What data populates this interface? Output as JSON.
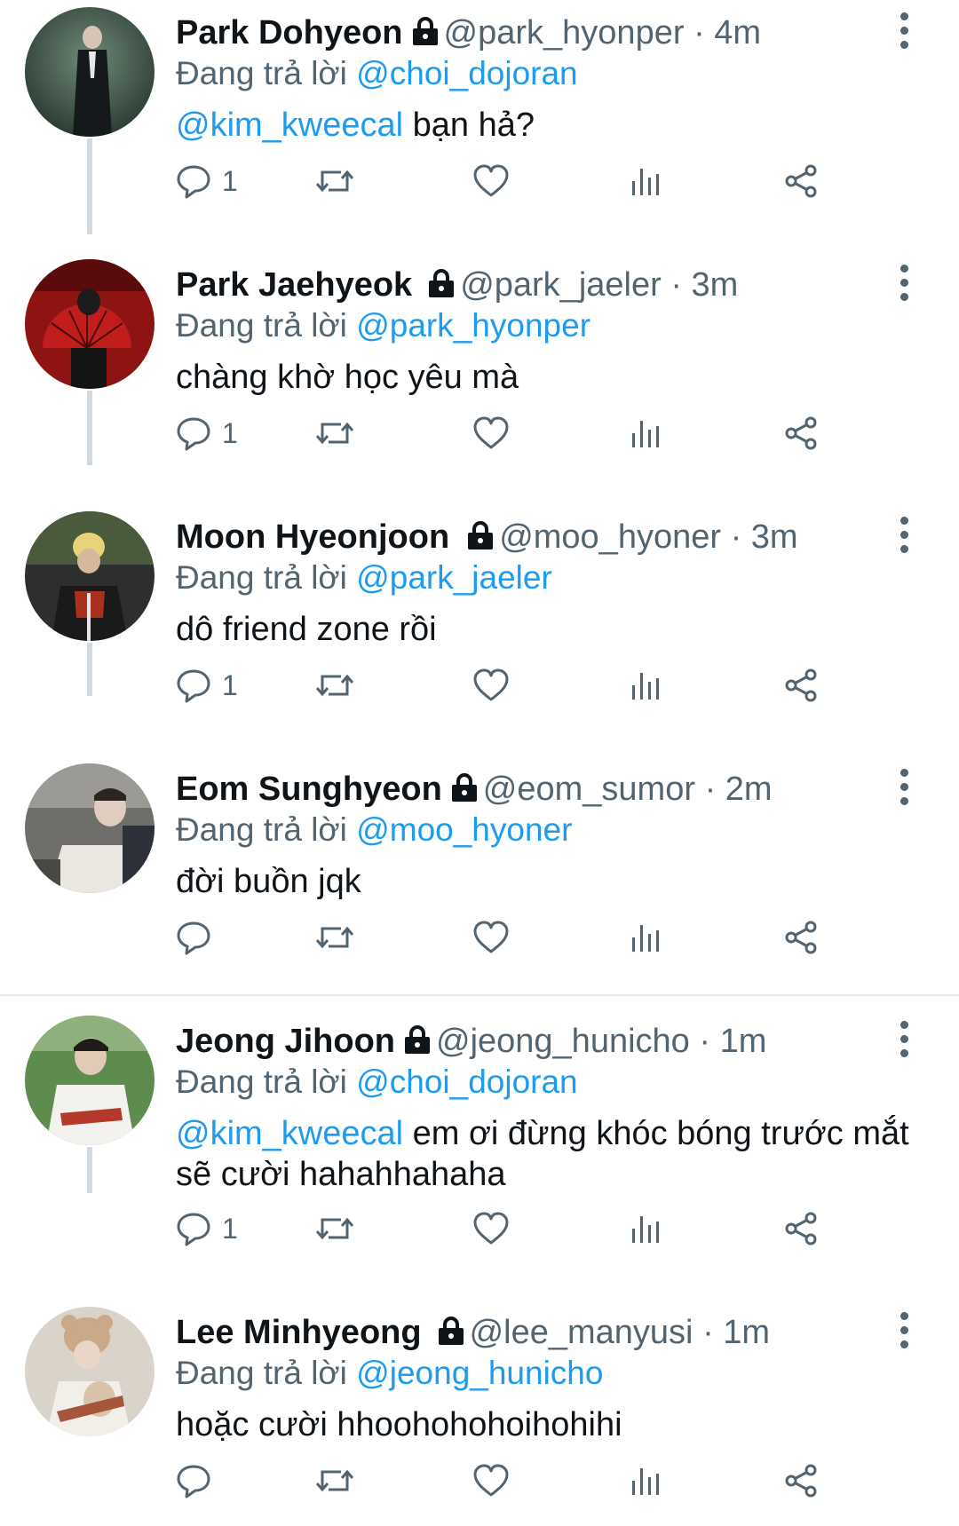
{
  "replying_prefix": "Đang trả lời",
  "tweets": [
    {
      "name": "Park Dohyeon",
      "handle": "@park_hyonper",
      "sep": "·",
      "time": "4m",
      "reply_to": "@choi_dojoran",
      "mention": "@kim_kweecal",
      "text": " bạn hả?",
      "reply_count": "1"
    },
    {
      "name": "Park Jaehyeok",
      "handle": "@park_jaeler",
      "sep": "·",
      "time": "3m",
      "reply_to": "@park_hyonper",
      "mention": "",
      "text": "chàng khờ học yêu mà",
      "reply_count": "1"
    },
    {
      "name": "Moon Hyeonjoon",
      "handle": "@moo_hyoner",
      "sep": "·",
      "time": "3m",
      "reply_to": "@park_jaeler",
      "mention": "",
      "text": "dô friend zone rồi",
      "reply_count": "1"
    },
    {
      "name": "Eom Sunghyeon",
      "handle": "@eom_sumor",
      "sep": "·",
      "time": "2m",
      "reply_to": "@moo_hyoner",
      "mention": "",
      "text": "đời buồn jqk",
      "reply_count": ""
    },
    {
      "name": "Jeong Jihoon",
      "handle": "@jeong_hunicho",
      "sep": "·",
      "time": "1m",
      "reply_to": "@choi_dojoran",
      "mention": "@kim_kweecal",
      "text": " em ơi đừng khóc bóng trước mắt sẽ cười hahahhahaha",
      "reply_count": "1"
    },
    {
      "name": "Lee Minhyeong",
      "handle": "@lee_manyusi",
      "sep": "·",
      "time": "1m",
      "reply_to": "@jeong_hunicho",
      "mention": "",
      "text": "hoặc cười hhoohohohoihohihi",
      "reply_count": ""
    }
  ],
  "colors": {
    "accent": "#1d9bf0",
    "secondary_text": "#536471",
    "primary_text": "#0f1419",
    "thread_line": "#cfd9de"
  },
  "icons": [
    "lock-icon",
    "more-options-icon",
    "reply-icon",
    "retweet-icon",
    "like-icon",
    "views-icon",
    "share-icon"
  ]
}
